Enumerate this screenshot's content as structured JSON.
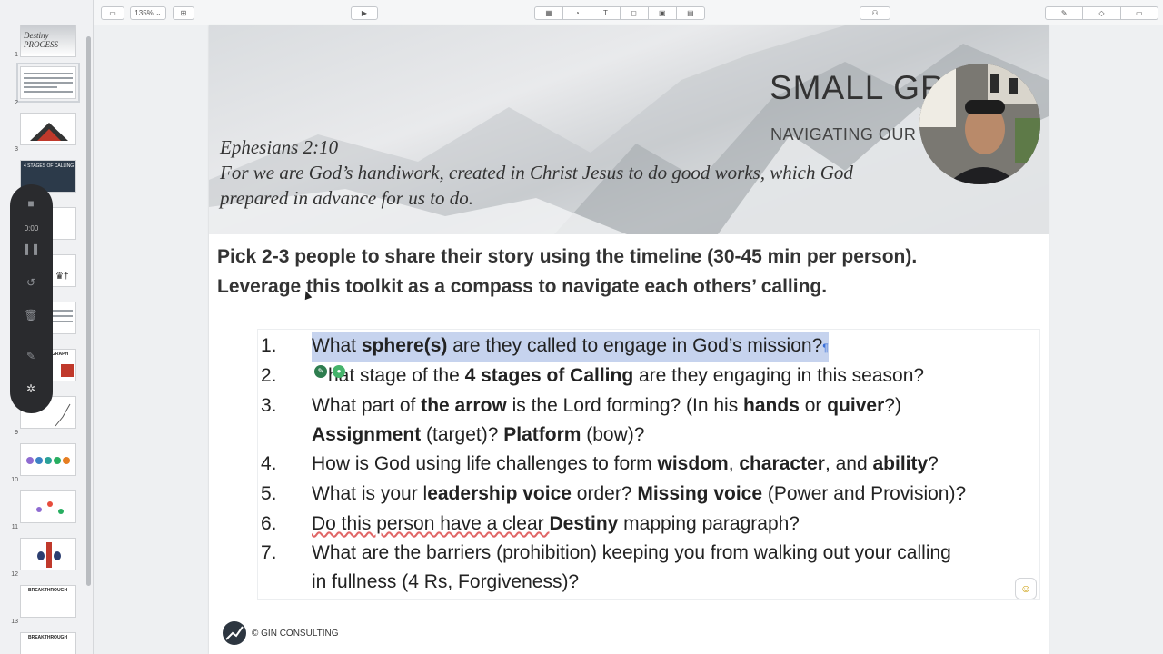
{
  "toolbar": {
    "zoom": "135%",
    "icons": [
      "sidebar-toggle-icon",
      "add-slide-icon",
      "play-icon",
      "table-icon",
      "chart-icon",
      "text-icon",
      "shape-icon",
      "media-icon",
      "comment-icon",
      "collaborate-icon",
      "format-icon",
      "animate-icon",
      "document-icon"
    ]
  },
  "thumbnails": [
    {
      "num": "1",
      "label": "Destiny PROCESS"
    },
    {
      "num": "2",
      "label": ""
    },
    {
      "num": "3",
      "label": ""
    },
    {
      "num": "",
      "label": "4 STAGES OF CALLING"
    },
    {
      "num": "",
      "label": ""
    },
    {
      "num": "",
      "label": ""
    },
    {
      "num": "",
      "label": ""
    },
    {
      "num": "",
      "label": "GRAPH"
    },
    {
      "num": "9",
      "label": ""
    },
    {
      "num": "10",
      "label": ""
    },
    {
      "num": "11",
      "label": ""
    },
    {
      "num": "12",
      "label": ""
    },
    {
      "num": "13",
      "label": "BREAKTHROUGH"
    },
    {
      "num": "",
      "label": "BREAKTHROUGH"
    }
  ],
  "recorder": {
    "time": "0:00"
  },
  "slide": {
    "title": "SMALL GR",
    "subtitle": "NAVIGATING OUR C",
    "verse_ref": "Ephesians 2:10",
    "verse_line1": "For we are God’s handiwork, created in Christ Jesus to do good works, which God",
    "verse_line2": "prepared in advance for us to do.",
    "instruction_line1": "Pick 2-3 people to share their story using the timeline (30-45 min per person).",
    "instruction_line2": "Leverage this toolkit as a compass to navigate each others’ calling.",
    "questions": {
      "q1": {
        "num": "1.",
        "a": "What ",
        "b": "sphere(s)",
        "c": " are they called to engage in God’s mission?"
      },
      "q2": {
        "num": "2.",
        "a": "hat stage of the ",
        "b": "4 stages of Calling",
        "c": " are they engaging in this season?"
      },
      "q3": {
        "num": "3.",
        "a": "What part of ",
        "b": "the arrow",
        "c": " is the Lord forming? (In his ",
        "d": "hands",
        "e": " or ",
        "f": "quiver",
        "g": "?)"
      },
      "q3b": {
        "a": "Assignment",
        "b": " (target)? ",
        "c": "Platform",
        "d": " (bow)?"
      },
      "q4": {
        "num": "4.",
        "a": "How is God using life challenges to form ",
        "b": "wisdom",
        "c": ", ",
        "d": "character",
        "e": ", and ",
        "f": "ability",
        "g": "?"
      },
      "q5": {
        "num": "5.",
        "a": "What is your l",
        "b": "eadership voice",
        "c": " order? ",
        "d": "Missing voice",
        "e": " (Power and Provision)?"
      },
      "q6": {
        "num": "6.",
        "a": "Do this person have a clear ",
        "b": "Destiny",
        "c": " mapping paragraph?"
      },
      "q7": {
        "num": "7.",
        "a": "What are the barriers (prohibition) keeping you from walking out your calling"
      },
      "q7b": {
        "a": "in fullness (4 Rs, Forgiveness)?"
      }
    },
    "footer": "© GIN CONSULTING"
  }
}
